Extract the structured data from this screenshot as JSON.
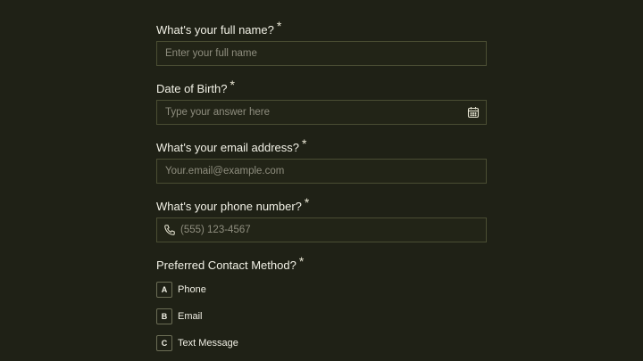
{
  "form": {
    "questions": [
      {
        "label": "What's your full name?",
        "required_mark": "*",
        "placeholder": "Enter your full name",
        "value": ""
      },
      {
        "label": "Date of Birth?",
        "required_mark": "*",
        "placeholder": "Type your answer here",
        "value": "",
        "icon": "calendar-icon"
      },
      {
        "label": "What's your email address?",
        "required_mark": "*",
        "placeholder": "Your.email@example.com",
        "value": ""
      },
      {
        "label": "What's your phone number?",
        "required_mark": "*",
        "placeholder": "(555) 123-4567",
        "value": "",
        "icon": "phone-icon"
      }
    ],
    "contact_method": {
      "label": "Preferred Contact Method?",
      "required_mark": "*",
      "options": [
        {
          "key": "A",
          "label": "Phone"
        },
        {
          "key": "B",
          "label": "Email"
        },
        {
          "key": "C",
          "label": "Text Message"
        }
      ]
    }
  },
  "colors": {
    "background": "#1f2116",
    "field_border": "#4a4d33",
    "text": "#f2f1e6",
    "placeholder": "#8f8e7f"
  }
}
